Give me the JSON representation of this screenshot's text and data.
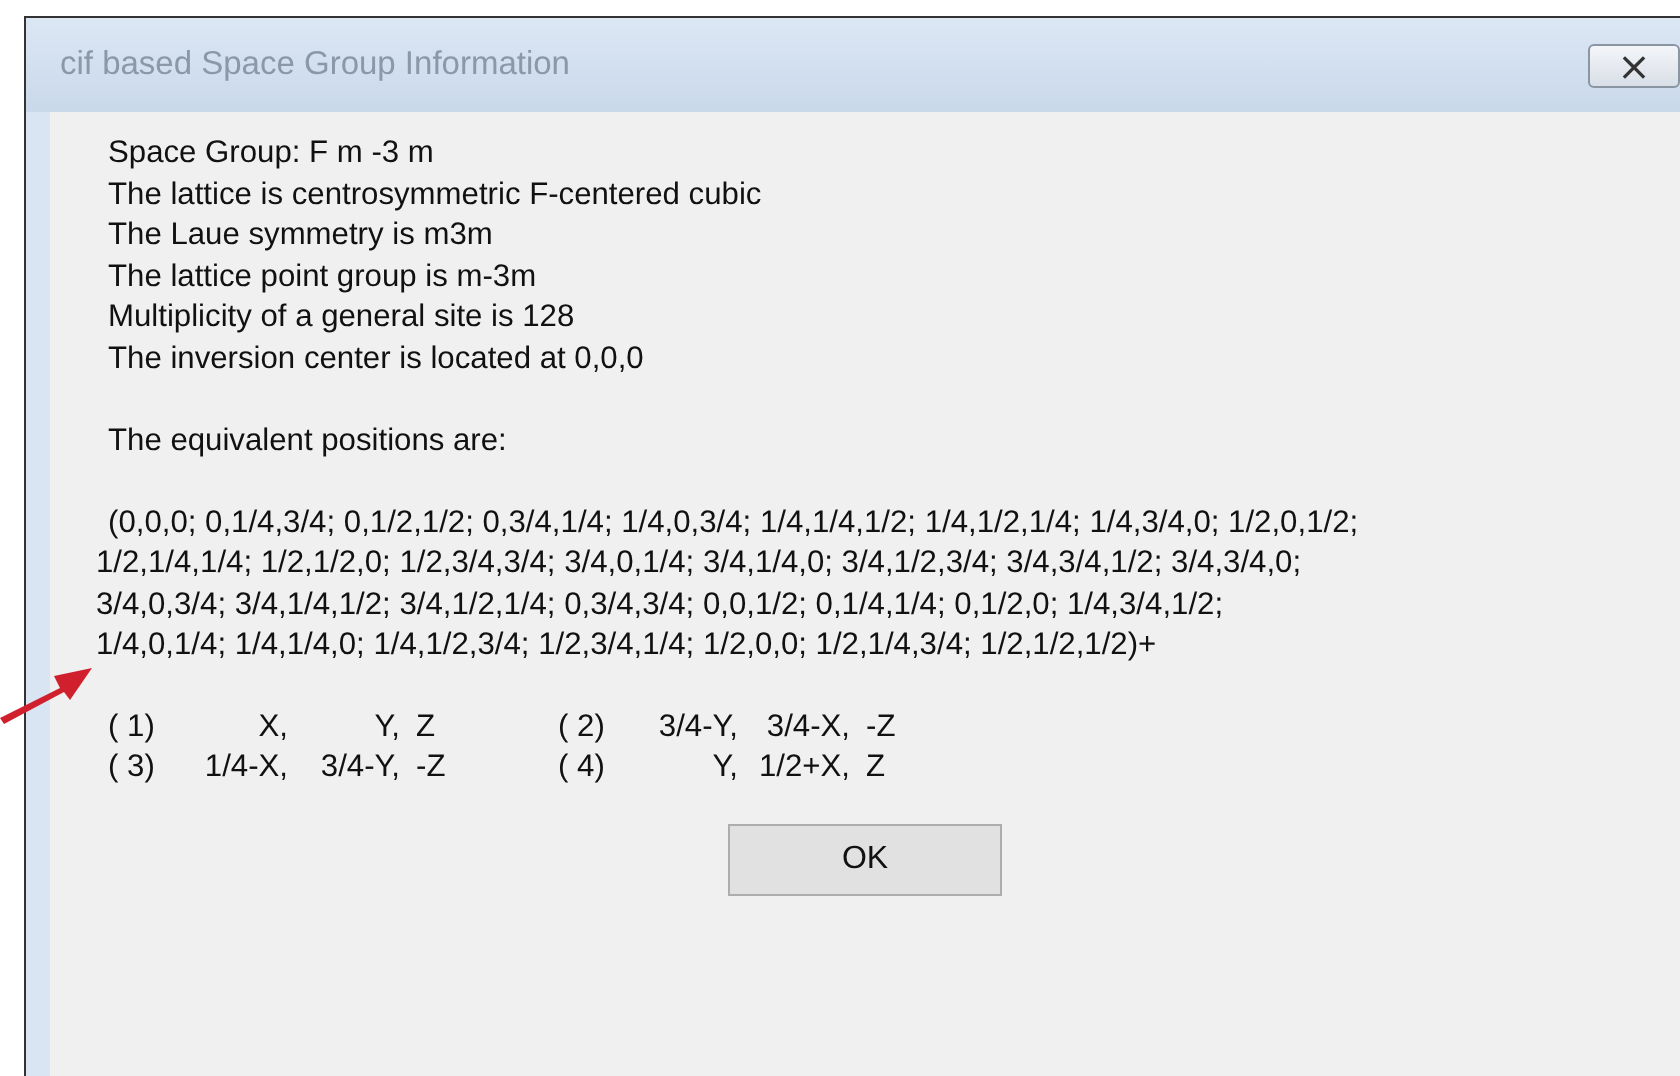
{
  "window": {
    "title": "cif based Space Group Information",
    "close": "×"
  },
  "info_lines": [
    "Space Group: F m -3 m",
    "The lattice is centrosymmetric F-centered cubic",
    "The Laue symmetry is m3m",
    "The lattice point group is m-3m",
    "Multiplicity of a general site is 128",
    "The inversion center is located at 0,0,0"
  ],
  "positions_heading": "The equivalent positions are:",
  "positions_lines": [
    "(0,0,0; 0,1/4,3/4; 0,1/2,1/2; 0,3/4,1/4; 1/4,0,3/4; 1/4,1/4,1/2; 1/4,1/2,1/4; 1/4,3/4,0; 1/2,0,1/2;",
    "1/2,1/4,1/4; 1/2,1/2,0; 1/2,3/4,3/4; 3/4,0,1/4; 3/4,1/4,0; 3/4,1/2,3/4; 3/4,3/4,1/2; 3/4,3/4,0;",
    "3/4,0,3/4; 3/4,1/4,1/2; 3/4,1/2,1/4; 0,3/4,3/4; 0,0,1/2; 0,1/4,1/4; 0,1/2,0; 1/4,3/4,1/2;",
    "1/4,0,1/4; 1/4,1/4,0; 1/4,1/2,3/4; 1/2,3/4,1/4; 1/2,0,0; 1/2,1/4,3/4; 1/2,1/2,1/2)+"
  ],
  "operators": [
    {
      "index": "( 1)",
      "x": "X,",
      "y": "Y,",
      "z": "Z"
    },
    {
      "index": "( 2)",
      "x": "3/4-Y,",
      "y": "3/4-X,",
      "z": "-Z"
    },
    {
      "index": "( 3)",
      "x": "1/4-X,",
      "y": "3/4-Y,",
      "z": "-Z"
    },
    {
      "index": "( 4)",
      "x": "Y,",
      "y": "1/2+X,",
      "z": "Z"
    }
  ],
  "buttons": [
    "OK"
  ]
}
